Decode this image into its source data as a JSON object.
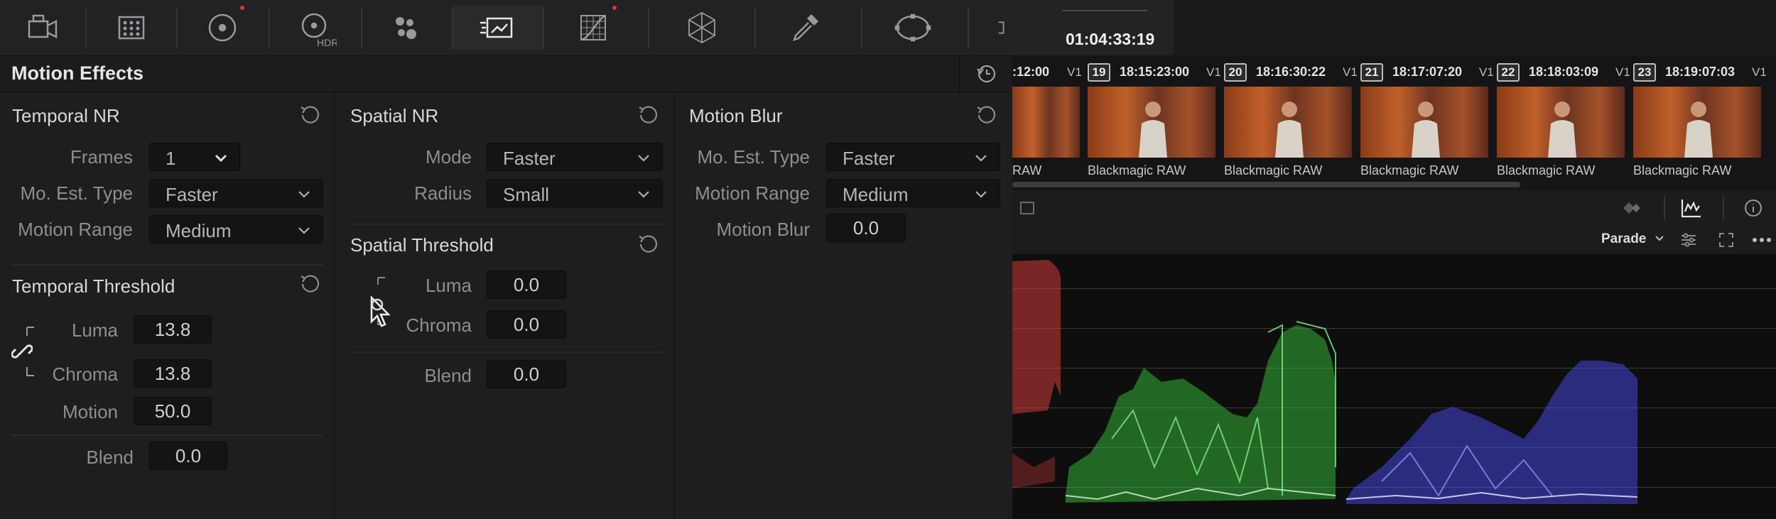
{
  "toolbar": {
    "icons": [
      "camera-raw-icon",
      "color-match-icon",
      "color-wheels-icon",
      "hdr-wheels-icon",
      "rgb-mixer-icon",
      "motion-effects-icon",
      "curves-icon",
      "color-warper-icon",
      "qualifier-icon",
      "window-icon",
      "tracker-icon"
    ],
    "hdr_label": "HDR"
  },
  "panel": {
    "title": "Motion Effects",
    "temporal_nr": {
      "title": "Temporal NR",
      "frames_label": "Frames",
      "frames_value": "1",
      "mo_est_label": "Mo. Est. Type",
      "mo_est_value": "Faster",
      "motion_range_label": "Motion Range",
      "motion_range_value": "Medium"
    },
    "temporal_threshold": {
      "title": "Temporal Threshold",
      "luma_label": "Luma",
      "luma_value": "13.8",
      "chroma_label": "Chroma",
      "chroma_value": "13.8",
      "motion_label": "Motion",
      "motion_value": "50.0",
      "blend_label": "Blend",
      "blend_value": "0.0"
    },
    "spatial_nr": {
      "title": "Spatial NR",
      "mode_label": "Mode",
      "mode_value": "Faster",
      "radius_label": "Radius",
      "radius_value": "Small"
    },
    "spatial_threshold": {
      "title": "Spatial Threshold",
      "luma_label": "Luma",
      "luma_value": "0.0",
      "chroma_label": "Chroma",
      "chroma_value": "0.0",
      "blend_label": "Blend",
      "blend_value": "0.0"
    },
    "motion_blur": {
      "title": "Motion Blur",
      "mo_est_label": "Mo. Est. Type",
      "mo_est_value": "Faster",
      "motion_range_label": "Motion Range",
      "motion_range_value": "Medium",
      "blur_label": "Motion Blur",
      "blur_value": "0.0"
    }
  },
  "viewer": {
    "timecode": "01:04:33:19"
  },
  "clips": [
    {
      "num": "",
      "tc": ":12:00",
      "track": "V1",
      "name": "RAW"
    },
    {
      "num": "19",
      "tc": "18:15:23:00",
      "track": "V1",
      "name": "Blackmagic RAW"
    },
    {
      "num": "20",
      "tc": "18:16:30:22",
      "track": "V1",
      "name": "Blackmagic RAW"
    },
    {
      "num": "21",
      "tc": "18:17:07:20",
      "track": "V1",
      "name": "Blackmagic RAW"
    },
    {
      "num": "22",
      "tc": "18:18:03:09",
      "track": "V1",
      "name": "Blackmagic RAW"
    },
    {
      "num": "23",
      "tc": "18:19:07:03",
      "track": "V1",
      "name": "Blackmagic RAW"
    }
  ],
  "scope": {
    "mode": "Parade",
    "colors": {
      "red": "#d23a3a",
      "green": "#3fd43f",
      "blue": "#4a4af0"
    }
  }
}
